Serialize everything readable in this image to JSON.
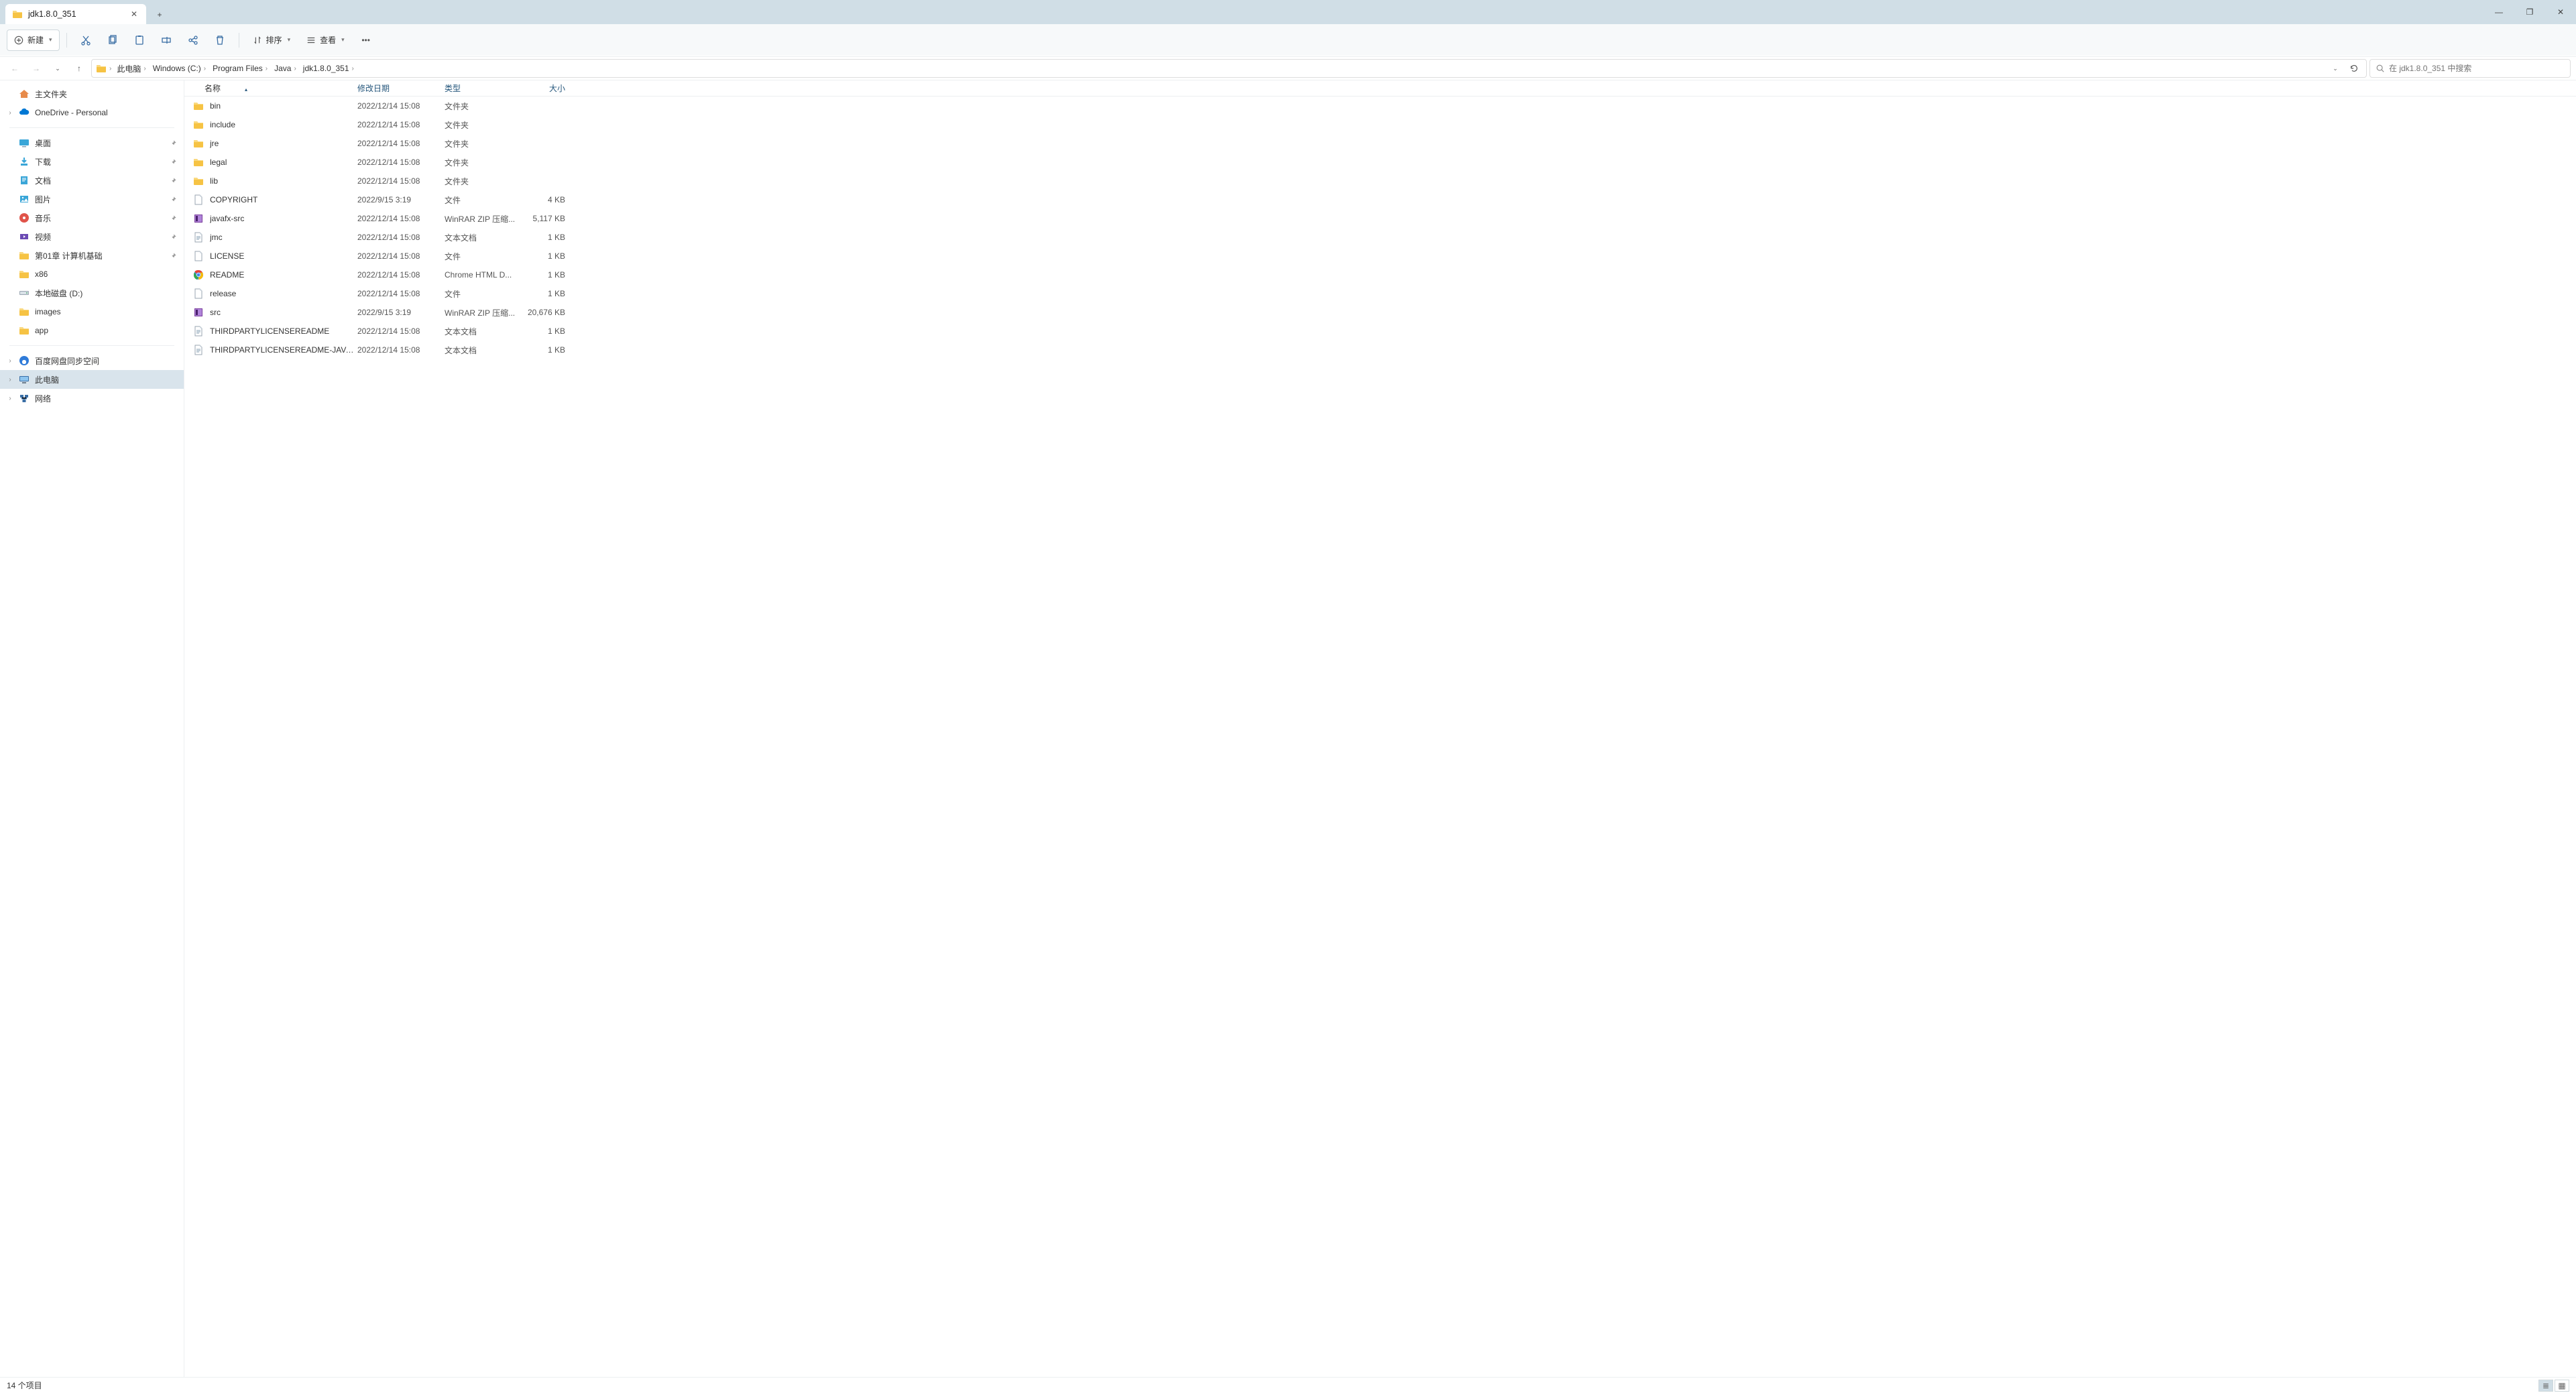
{
  "tab": {
    "title": "jdk1.8.0_351"
  },
  "window_controls": {
    "min": "—",
    "max": "❐",
    "close": "✕",
    "newtab": "+"
  },
  "toolbar": {
    "new": "新建",
    "sort": "排序",
    "view": "查看"
  },
  "address": {
    "crumbs": [
      "此电脑",
      "Windows (C:)",
      "Program Files",
      "Java",
      "jdk1.8.0_351"
    ]
  },
  "search": {
    "placeholder": "在 jdk1.8.0_351 中搜索"
  },
  "sidebar": {
    "home": "主文件夹",
    "onedrive": "OneDrive - Personal",
    "quick": [
      {
        "label": "桌面",
        "icon": "desktop",
        "pin": true
      },
      {
        "label": "下载",
        "icon": "download",
        "pin": true
      },
      {
        "label": "文档",
        "icon": "docs",
        "pin": true
      },
      {
        "label": "图片",
        "icon": "pictures",
        "pin": true
      },
      {
        "label": "音乐",
        "icon": "music",
        "pin": true
      },
      {
        "label": "视频",
        "icon": "video",
        "pin": true
      },
      {
        "label": "第01章 计算机基础",
        "icon": "folder",
        "pin": true
      },
      {
        "label": "x86",
        "icon": "folder",
        "pin": false
      },
      {
        "label": "本地磁盘 (D:)",
        "icon": "drive",
        "pin": false
      },
      {
        "label": "images",
        "icon": "folder",
        "pin": false
      },
      {
        "label": "app",
        "icon": "folder",
        "pin": false
      }
    ],
    "tree": [
      {
        "label": "百度网盘同步空间",
        "icon": "baidu"
      },
      {
        "label": "此电脑",
        "icon": "pc",
        "selected": true
      },
      {
        "label": "网络",
        "icon": "network"
      }
    ]
  },
  "columns": {
    "name": "名称",
    "date": "修改日期",
    "type": "类型",
    "size": "大小"
  },
  "files": [
    {
      "name": "bin",
      "date": "2022/12/14 15:08",
      "type": "文件夹",
      "size": "",
      "icon": "folder"
    },
    {
      "name": "include",
      "date": "2022/12/14 15:08",
      "type": "文件夹",
      "size": "",
      "icon": "folder"
    },
    {
      "name": "jre",
      "date": "2022/12/14 15:08",
      "type": "文件夹",
      "size": "",
      "icon": "folder"
    },
    {
      "name": "legal",
      "date": "2022/12/14 15:08",
      "type": "文件夹",
      "size": "",
      "icon": "folder"
    },
    {
      "name": "lib",
      "date": "2022/12/14 15:08",
      "type": "文件夹",
      "size": "",
      "icon": "folder"
    },
    {
      "name": "COPYRIGHT",
      "date": "2022/9/15 3:19",
      "type": "文件",
      "size": "4 KB",
      "icon": "file"
    },
    {
      "name": "javafx-src",
      "date": "2022/12/14 15:08",
      "type": "WinRAR ZIP 压缩...",
      "size": "5,117 KB",
      "icon": "zip"
    },
    {
      "name": "jmc",
      "date": "2022/12/14 15:08",
      "type": "文本文档",
      "size": "1 KB",
      "icon": "txt"
    },
    {
      "name": "LICENSE",
      "date": "2022/12/14 15:08",
      "type": "文件",
      "size": "1 KB",
      "icon": "file"
    },
    {
      "name": "README",
      "date": "2022/12/14 15:08",
      "type": "Chrome HTML D...",
      "size": "1 KB",
      "icon": "chrome"
    },
    {
      "name": "release",
      "date": "2022/12/14 15:08",
      "type": "文件",
      "size": "1 KB",
      "icon": "file"
    },
    {
      "name": "src",
      "date": "2022/9/15 3:19",
      "type": "WinRAR ZIP 压缩...",
      "size": "20,676 KB",
      "icon": "zip"
    },
    {
      "name": "THIRDPARTYLICENSEREADME",
      "date": "2022/12/14 15:08",
      "type": "文本文档",
      "size": "1 KB",
      "icon": "txt"
    },
    {
      "name": "THIRDPARTYLICENSEREADME-JAVAFX",
      "date": "2022/12/14 15:08",
      "type": "文本文档",
      "size": "1 KB",
      "icon": "txt"
    }
  ],
  "status": {
    "text": "14 个项目"
  }
}
